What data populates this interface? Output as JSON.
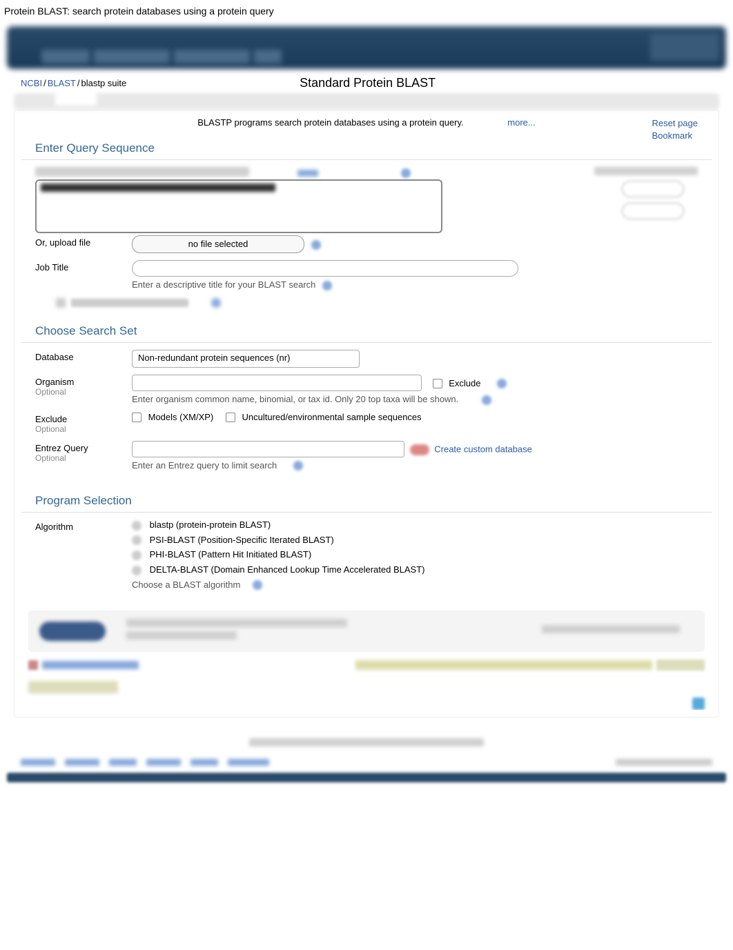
{
  "page_title": "Protein BLAST: search protein databases using a protein query",
  "breadcrumb": {
    "ncbi": "NCBI",
    "blast": "BLAST",
    "current": "blastp suite"
  },
  "main_title": "Standard Protein BLAST",
  "info_text": "BLASTP programs search protein databases using a protein query.",
  "more_link": "more...",
  "page_links": {
    "reset": "Reset page",
    "bookmark": "Bookmark"
  },
  "sections": {
    "query": {
      "legend": "Enter Query Sequence",
      "upload_label": "Or, upload file",
      "file_status": "no file selected",
      "job_title_label": "Job Title",
      "job_title_hint": "Enter a descriptive title for your BLAST search"
    },
    "search_set": {
      "legend": "Choose Search Set",
      "database_label": "Database",
      "database_value": "Non-redundant protein sequences (nr)",
      "organism_label": "Organism",
      "optional": "Optional",
      "organism_hint": "Enter organism common name, binomial, or tax id. Only 20 top taxa will be shown.",
      "exclude_cb_label": "Exclude",
      "exclude_label": "Exclude",
      "exclude_models": "Models (XM/XP)",
      "exclude_uncultured": "Uncultured/environmental sample sequences",
      "entrez_label": "Entrez Query",
      "entrez_hint": "Enter an Entrez query to limit search",
      "create_db": "Create custom database"
    },
    "program": {
      "legend": "Program Selection",
      "algorithm_label": "Algorithm",
      "algorithms": [
        "blastp (protein-protein BLAST)",
        "PSI-BLAST (Position-Specific Iterated BLAST)",
        "PHI-BLAST (Pattern Hit Initiated BLAST)",
        "DELTA-BLAST (Domain Enhanced Lookup Time Accelerated BLAST)"
      ],
      "algorithm_hint": "Choose a BLAST algorithm"
    }
  }
}
